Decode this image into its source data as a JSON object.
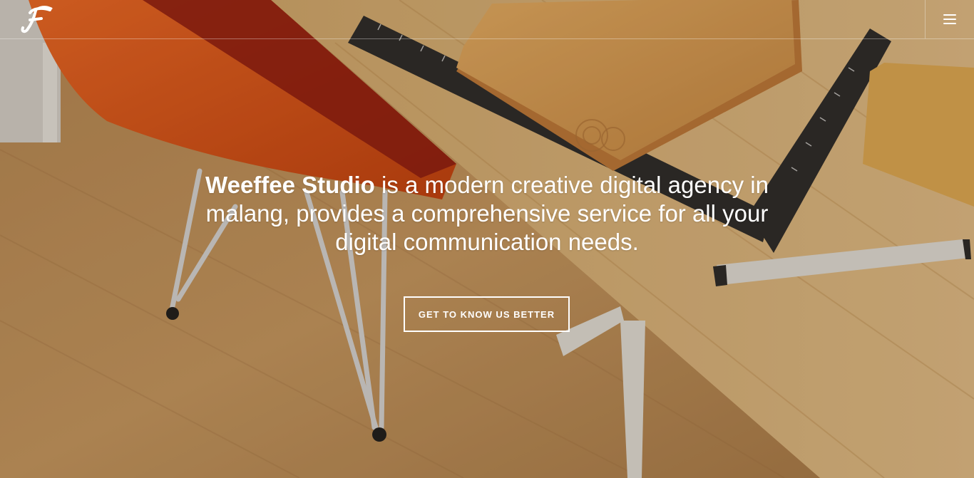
{
  "brand": {
    "logo_letter": "F",
    "logo_icon": "script-f-logo-icon"
  },
  "nav": {
    "menu_icon": "hamburger-menu-icon"
  },
  "hero": {
    "studio_name": "Weeffee Studio",
    "tagline_rest": " is a modern creative digital agency in malang, provides a comprehensive service for all your digital communication needs.",
    "cta_label": "GET TO KNOW US BETTER"
  },
  "colors": {
    "text": "#ffffff",
    "chair_orange": "#e5571a",
    "desk_wood": "#d8b070",
    "notebook": "#e0a55a",
    "ruler": "#2a2a2a"
  }
}
